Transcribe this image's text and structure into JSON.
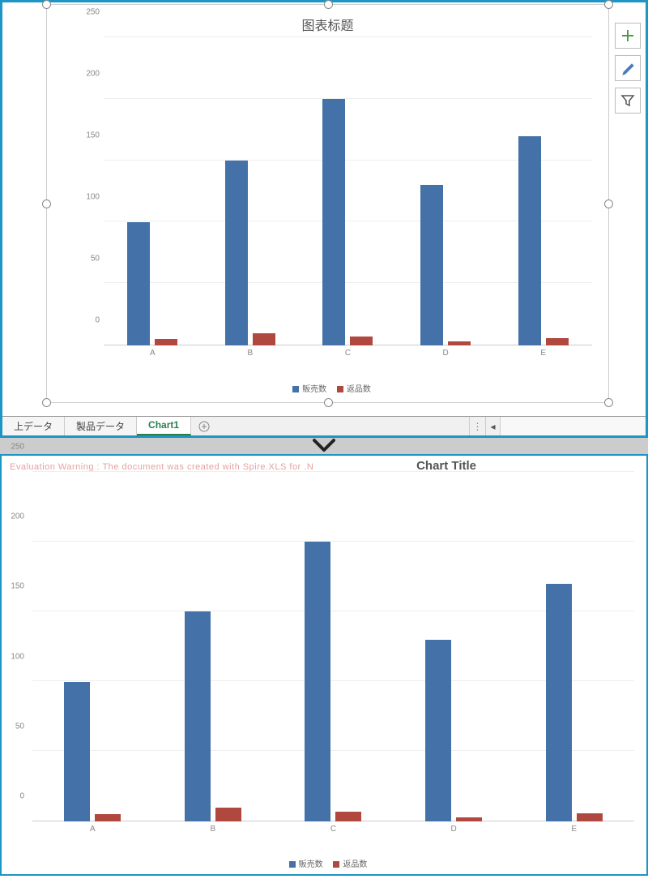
{
  "top_panel": {
    "chart_title": "图表标题",
    "tabs": [
      "上データ",
      "製品データ",
      "Chart1"
    ],
    "active_tab_index": 2
  },
  "bottom_panel": {
    "warning_text": "Evaluation Warning : The document was created with  Spire.XLS for .N",
    "chart_title": "Chart Title"
  },
  "chart_data": [
    {
      "type": "bar",
      "title": "图表标题",
      "categories": [
        "A",
        "B",
        "C",
        "D",
        "E"
      ],
      "series": [
        {
          "name": "販売数",
          "values": [
            100,
            150,
            200,
            130,
            170
          ],
          "color": "#4472a8"
        },
        {
          "name": "返品数",
          "values": [
            5,
            10,
            7,
            3,
            6
          ],
          "color": "#b1483f"
        }
      ],
      "ylim": [
        0,
        250
      ],
      "yticks": [
        0,
        50,
        100,
        150,
        200,
        250
      ]
    },
    {
      "type": "bar",
      "title": "Chart Title",
      "categories": [
        "A",
        "B",
        "C",
        "D",
        "E"
      ],
      "series": [
        {
          "name": "販売数",
          "values": [
            100,
            150,
            200,
            130,
            170
          ],
          "color": "#4472a8"
        },
        {
          "name": "返品数",
          "values": [
            5,
            10,
            7,
            3,
            6
          ],
          "color": "#b1483f"
        }
      ],
      "ylim": [
        0,
        250
      ],
      "yticks": [
        0,
        50,
        100,
        150,
        200,
        250
      ]
    }
  ],
  "legend": {
    "series1": "販売数",
    "series2": "返品数"
  }
}
